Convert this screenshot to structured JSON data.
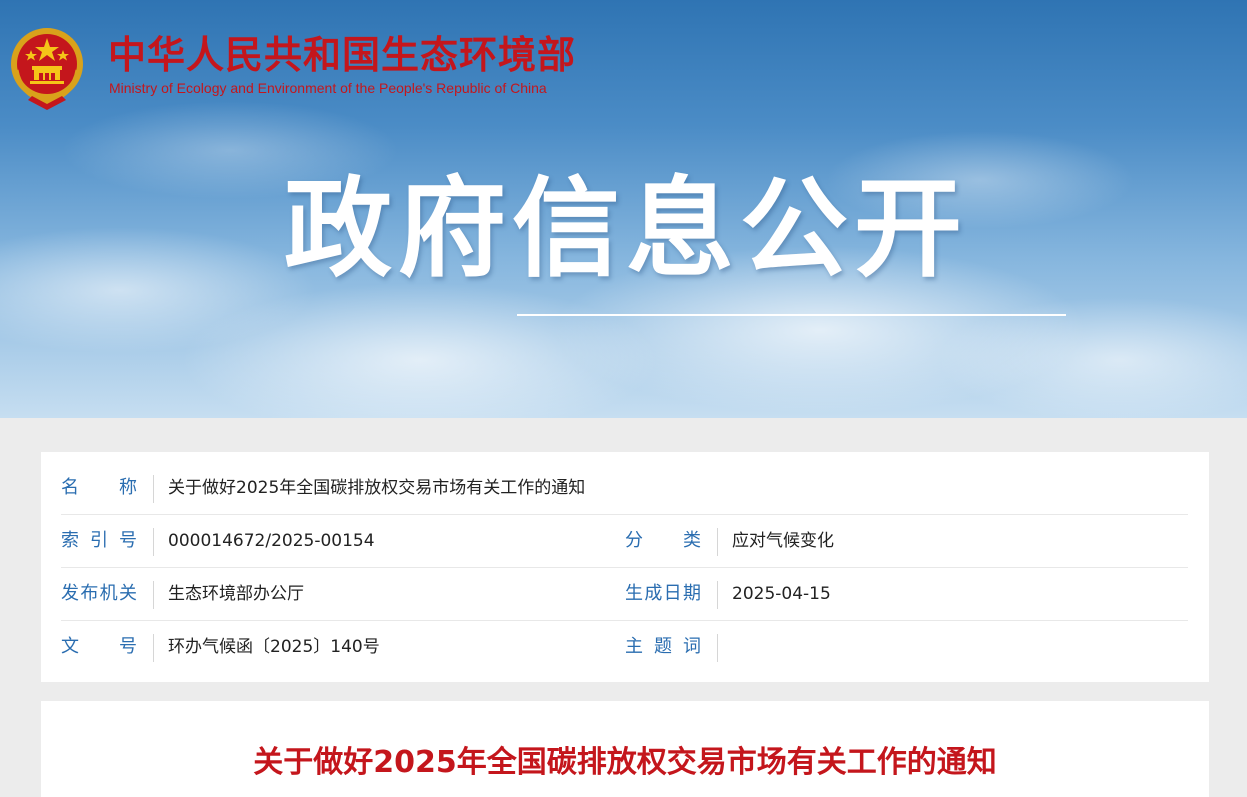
{
  "header": {
    "ministry_cn": "中华人民共和国生态环境部",
    "ministry_en": "Ministry of Ecology and Environment of the People's Republic of China",
    "banner_title": "政府信息公开"
  },
  "info": {
    "name_label": "名称",
    "name_value": "关于做好2025年全国碳排放权交易市场有关工作的通知",
    "index_label": "索引号",
    "index_value": "000014672/2025-00154",
    "category_label": "分类",
    "category_value": "应对气候变化",
    "issuer_label": "发布机关",
    "issuer_value": "生态环境部办公厅",
    "date_label": "生成日期",
    "date_value": "2025-04-15",
    "docno_label": "文号",
    "docno_value": "环办气候函〔2025〕140号",
    "keywords_label": "主题词",
    "keywords_value": ""
  },
  "article": {
    "title": "关于做好2025年全国碳排放权交易市场有关工作的通知"
  },
  "colors": {
    "brand_red": "#c4161c",
    "label_blue": "#2a6db0"
  },
  "icons": {
    "emblem": "national-emblem-icon"
  }
}
